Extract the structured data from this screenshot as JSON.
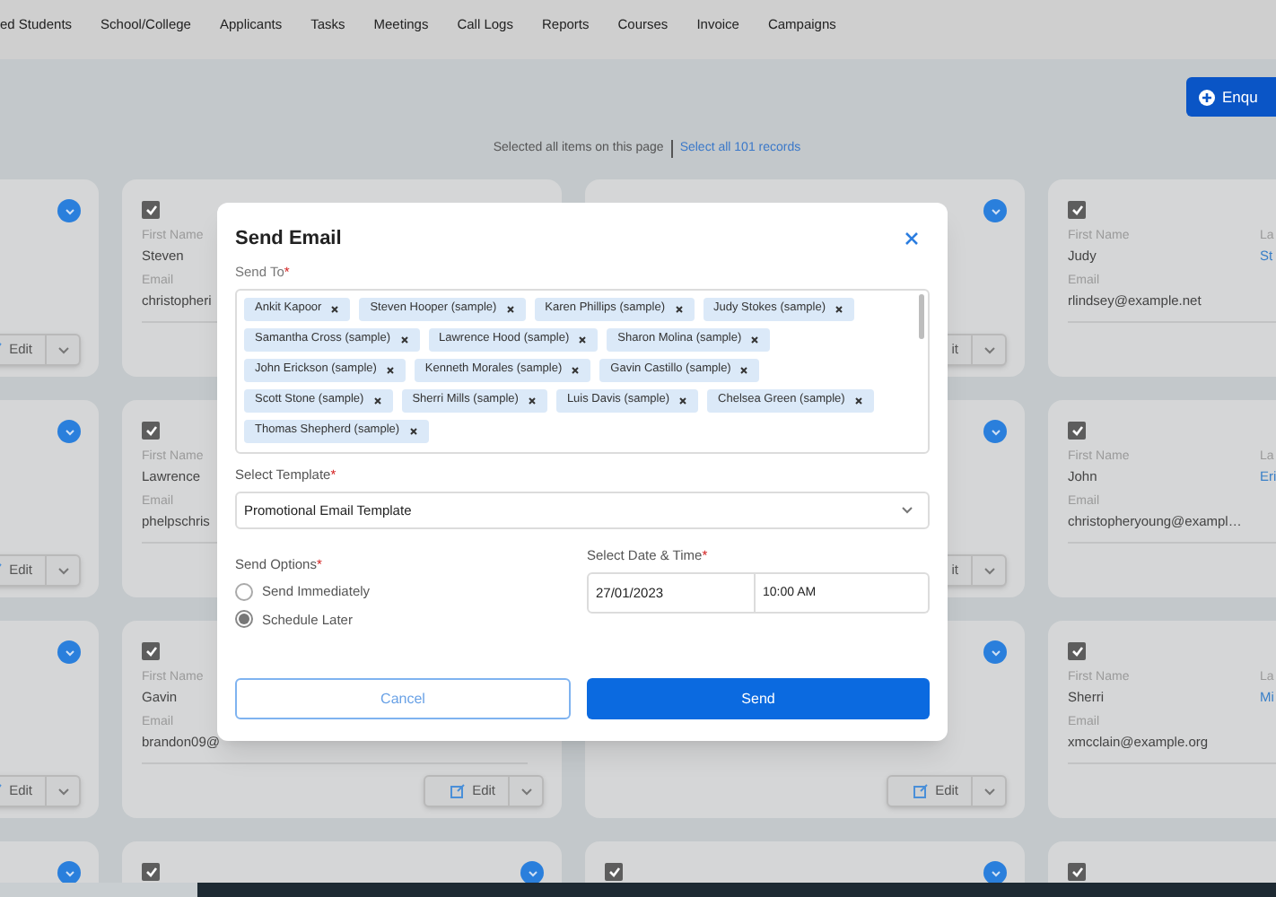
{
  "nav": {
    "items": [
      "ed Students",
      "School/College",
      "Applicants",
      "Tasks",
      "Meetings",
      "Call Logs",
      "Reports",
      "Courses",
      "Invoice",
      "Campaigns"
    ]
  },
  "enquiry_button": {
    "label": "Enqu"
  },
  "selection_bar": {
    "text": "Selected all items on this page",
    "link": "Select all 101 records"
  },
  "card_rows": [
    {
      "cards": [
        {
          "menu": true,
          "edit": "Edit"
        },
        {
          "checked": true,
          "first_name_label": "First Name",
          "first_name": "Steven",
          "email_label": "Email",
          "email": "christopheri"
        },
        {
          "menu": true,
          "edit": "it"
        },
        {
          "checked": true,
          "first_name_label": "First Name",
          "first_name": "Judy",
          "last_name_label": "La",
          "last_name": "St",
          "email_label": "Email",
          "email": "rlindsey@example.net"
        }
      ]
    },
    {
      "cards": [
        {
          "menu": true,
          "edit": "Edit"
        },
        {
          "checked": true,
          "first_name_label": "First Name",
          "first_name": "Lawrence",
          "email_label": "Email",
          "email": "phelpschris"
        },
        {
          "menu": true,
          "edit": "it"
        },
        {
          "checked": true,
          "first_name_label": "First Name",
          "first_name": "John",
          "last_name_label": "La",
          "last_name": "Eri",
          "email_label": "Email",
          "email": "christopheryoung@exampl…"
        }
      ]
    },
    {
      "cards": [
        {
          "menu": true,
          "edit": "Edit"
        },
        {
          "checked": true,
          "first_name_label": "First Name",
          "first_name": "Gavin",
          "email_label": "Email",
          "email": "brandon09@",
          "edit": "Edit"
        },
        {
          "menu": true,
          "edit": "Edit"
        },
        {
          "checked": true,
          "first_name_label": "First Name",
          "first_name": "Sherri",
          "last_name_label": "La",
          "last_name": "Mi",
          "email_label": "Email",
          "email": "xmcclain@example.org"
        }
      ]
    },
    {
      "cards": [
        {
          "menu": true
        },
        {
          "menu": true,
          "checked": true
        },
        {
          "menu": true,
          "checked": true
        },
        {
          "checked": true
        }
      ]
    }
  ],
  "modal": {
    "title": "Send Email",
    "required_mark": "*",
    "send_to_label": "Send To",
    "recipients": [
      "Ankit Kapoor",
      "Steven Hooper (sample)",
      "Karen Phillips (sample)",
      "Judy Stokes (sample)",
      "Samantha Cross (sample)",
      "Lawrence Hood (sample)",
      "Sharon Molina (sample)",
      "John Erickson (sample)",
      "Kenneth Morales (sample)",
      "Gavin Castillo (sample)",
      "Scott Stone (sample)",
      "Sherri Mills (sample)",
      "Luis Davis (sample)",
      "Chelsea Green (sample)",
      "Thomas Shepherd (sample)"
    ],
    "template_label": "Select Template",
    "template_value": "Promotional Email Template",
    "send_options_label": "Send Options",
    "options": [
      {
        "label": "Send Immediately",
        "selected": false
      },
      {
        "label": "Schedule Later",
        "selected": true
      }
    ],
    "datetime_label": "Select Date & Time",
    "date": "27/01/2023",
    "time": "10:00 AM",
    "cancel": "Cancel",
    "send": "Send"
  }
}
